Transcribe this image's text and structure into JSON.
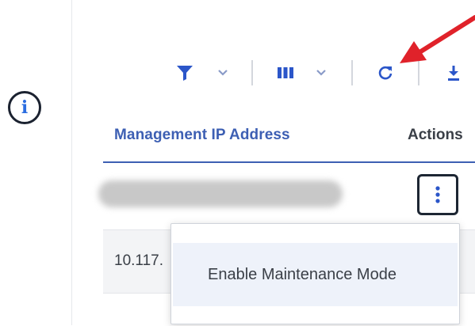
{
  "toolbar": {
    "filter_icon": "filter-icon",
    "columns_icon": "columns-icon",
    "refresh_icon": "refresh-icon",
    "download_icon": "download-icon",
    "accent_color": "#2b56c9"
  },
  "grid": {
    "columns": [
      "Management IP Address",
      "Actions"
    ],
    "rows": [
      {
        "ip": ""
      },
      {
        "ip": "10.117."
      }
    ]
  },
  "menu": {
    "items": [
      "Enable Maintenance Mode"
    ]
  },
  "annotation": {
    "arrow_color": "#e0222a"
  }
}
